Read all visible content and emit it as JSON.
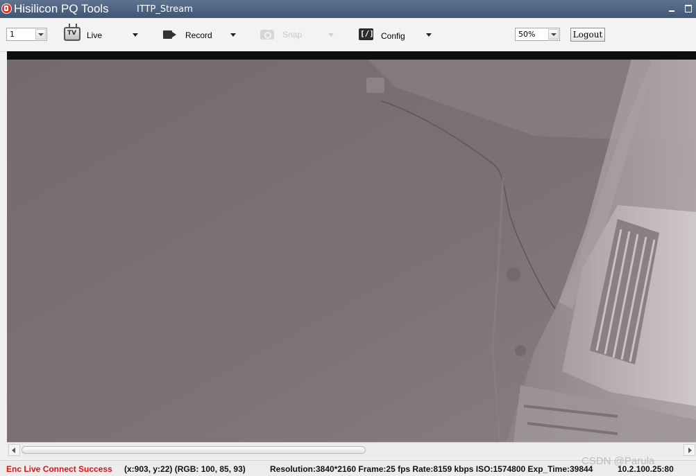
{
  "titlebar": {
    "app_title": "Hisilicon PQ Tools",
    "stream_title": "ITTP_Stream",
    "colors": {
      "background": "#4c6282",
      "text": "#ffffff"
    }
  },
  "toolbar": {
    "channel": {
      "selected": "1"
    },
    "live": {
      "label": "Live",
      "icon": "tv-icon"
    },
    "record": {
      "label": "Record",
      "icon": "video-camera-icon"
    },
    "snap": {
      "label": "Snap",
      "icon": "camera-icon",
      "enabled": false
    },
    "config": {
      "label": "Config",
      "icon": "config-icon"
    },
    "zoom": {
      "selected": "50%"
    },
    "logout_label": "Logout"
  },
  "video": {
    "description_icon": "live-video-preview"
  },
  "scrollbar": {
    "thumb_fraction": 0.5
  },
  "statusbar": {
    "connection": "Enc Live Connect Success",
    "coordinates": "(x:903, y:22) (RGB: 100, 85, 93)",
    "stream_info": "Resolution:3840*2160  Frame:25 fps  Rate:8159 kbps ISO:1574800 Exp_Time:39844",
    "ip": "10.2.100.25:80",
    "colors": {
      "connection": "#e01010"
    }
  },
  "watermark": "CSDN @Parula"
}
